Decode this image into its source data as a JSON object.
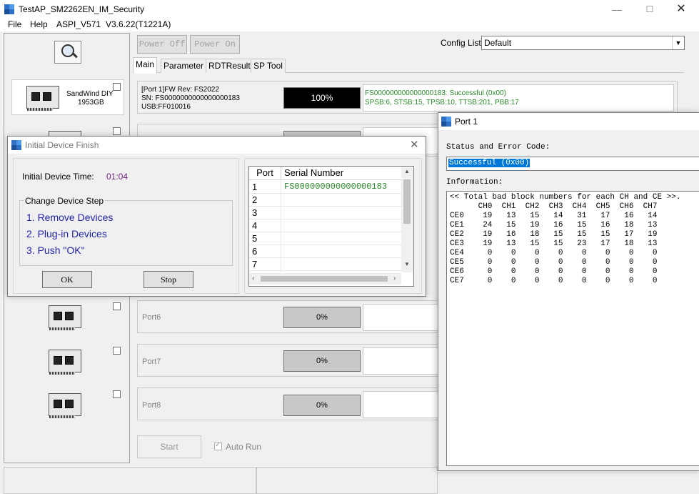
{
  "app": {
    "title": "TestAP_SM2262EN_IM_Security",
    "menu": [
      "File",
      "Help",
      "ASPI_V571",
      "V3.6.22(T1221A)"
    ]
  },
  "left_panel": {
    "device1": {
      "name": "SandWind DIY",
      "size": "1953GB"
    }
  },
  "toolbar": {
    "power_off": "Power Off",
    "power_on": "Power On",
    "config_label": "Config List",
    "config_value": "Default"
  },
  "tabs": [
    "Main",
    "Parameter",
    "RDTResult",
    "SP Tool"
  ],
  "port1_panel": {
    "info_line1": "[Port 1]FW Rev: FS2022",
    "info_line2": "SN: FS0000000000000000183",
    "info_line3": "USB:FF010016",
    "progress": "100%",
    "status_line1": "FS000000000000000183: Successful (0x00)",
    "status_line2": "SPSB:6, STSB:15, TPSB:10, TTSB:201, PBB:17"
  },
  "ports": [
    {
      "label": "Port6",
      "progress": "0%"
    },
    {
      "label": "Port7",
      "progress": "0%"
    },
    {
      "label": "Port8",
      "progress": "0%"
    }
  ],
  "bottom": {
    "start": "Start",
    "auto_run": "Auto Run"
  },
  "dialog": {
    "title": "Initial Device Finish",
    "time_label": "Initial Device Time:",
    "time_value": "01:04",
    "step_group": "Change Device Step",
    "steps": [
      "1. Remove Devices",
      "2. Plug-in Devices",
      "3. Push \"OK\""
    ],
    "ok": "OK",
    "stop": "Stop",
    "grid_headers": [
      "Port",
      "Serial Number"
    ],
    "rows": [
      {
        "port": "1",
        "serial": "FS000000000000000183"
      },
      {
        "port": "2",
        "serial": ""
      },
      {
        "port": "3",
        "serial": ""
      },
      {
        "port": "4",
        "serial": ""
      },
      {
        "port": "5",
        "serial": ""
      },
      {
        "port": "6",
        "serial": ""
      },
      {
        "port": "7",
        "serial": ""
      }
    ]
  },
  "port_window": {
    "title": "Port 1",
    "status_label": "Status and Error Code:",
    "status_value": "Successful (0x00)",
    "info_label": "Information:",
    "info_text": "<< Total bad block numbers for each CH and CE >>.\n      CH0  CH1  CH2  CH3  CH4  CH5  CH6  CH7\nCE0    19   13   15   14   31   17   16   14\nCE1    24   15   19   16   15   16   18   13\nCE2    19   16   18   15   15   15   17   19\nCE3    19   13   15   15   23   17   18   13\nCE4     0    0    0    0    0    0    0    0\nCE5     0    0    0    0    0    0    0    0\nCE6     0    0    0    0    0    0    0    0\nCE7     0    0    0    0    0    0    0    0"
  },
  "colors": {
    "accent_text": "#1f1fa8",
    "time_value": "#6a1f7a",
    "success_green": "#2a8a2a",
    "selection": "#0078d7",
    "progress_black": "#000000"
  }
}
